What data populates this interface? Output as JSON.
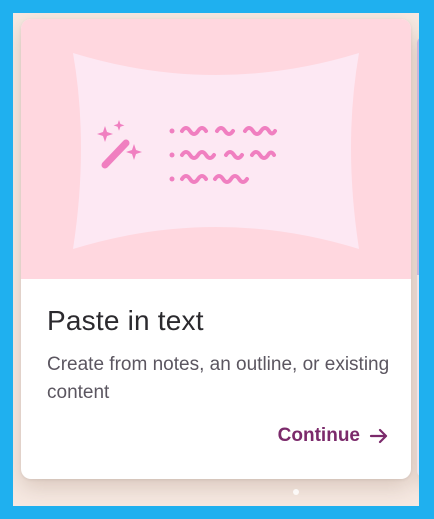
{
  "card": {
    "title": "Paste in text",
    "description": "Create from notes, an outline, or existing content",
    "action_label": "Continue",
    "illustration": "pasted-text-icon",
    "icons": {
      "sparkle": "magic-wand-icon",
      "arrow": "arrow-right-icon"
    }
  },
  "colors": {
    "outer_border": "#1fb0ef",
    "page_background": "#f6e9e2",
    "illustration_background": "#ffd7df",
    "illustration_panel": "#fde8f3",
    "illustration_accent": "#f07fc0",
    "title": "#2b2a2e",
    "description": "#5b5660",
    "action": "#7b2a6b",
    "next_card_accent": "#cdbde6"
  }
}
